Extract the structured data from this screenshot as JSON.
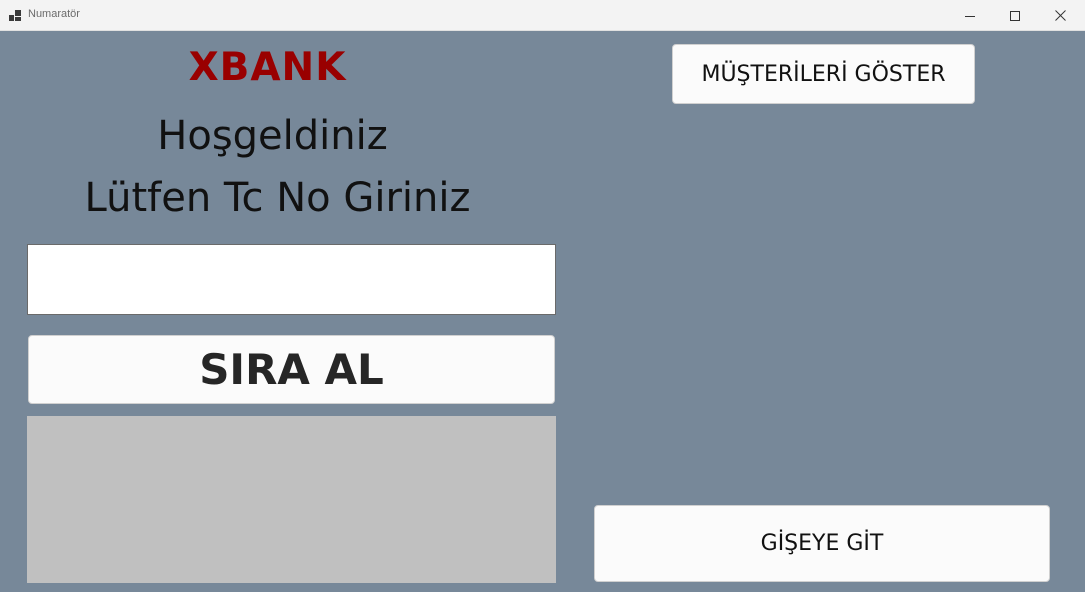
{
  "window": {
    "title": "Numaratör"
  },
  "main": {
    "brand": "XBANK",
    "welcome": "Hoşgeldiniz",
    "prompt": "Lütfen Tc No Giriniz",
    "tc_input": {
      "value": "",
      "placeholder": ""
    },
    "take_number_label": "SIRA AL",
    "show_customers_label": "MÜŞTERİLERİ GÖSTER",
    "go_to_counter_label": "GİŞEYE GİT"
  },
  "colors": {
    "background": "#778899",
    "brand": "#990000",
    "result_panel": "#c0c0c0"
  },
  "icons": {
    "app": "app-icon",
    "minimize": "minimize-icon",
    "maximize": "maximize-icon",
    "close": "close-icon"
  }
}
